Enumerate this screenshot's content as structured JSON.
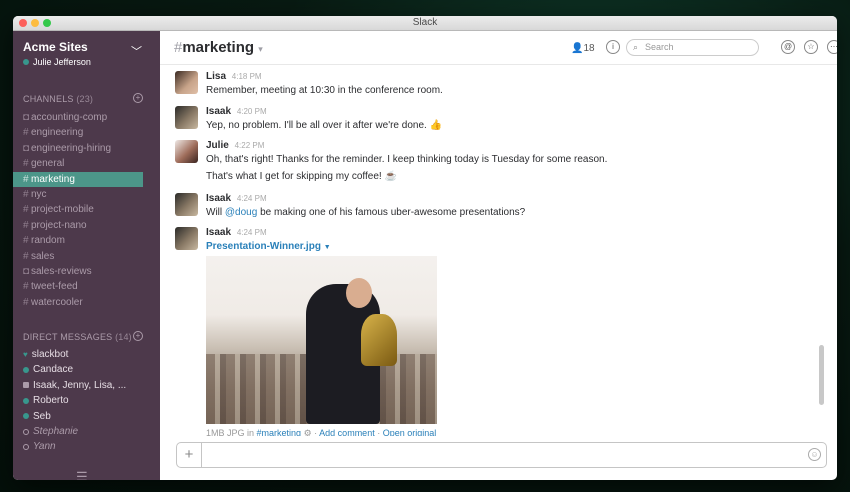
{
  "window": {
    "title": "Slack"
  },
  "team": {
    "name": "Acme Sites",
    "user": "Julie Jefferson"
  },
  "channels": {
    "header": "CHANNELS",
    "count": "(23)",
    "items": [
      {
        "prefix": "🔒",
        "name": "accounting-comp"
      },
      {
        "prefix": "#",
        "name": "engineering"
      },
      {
        "prefix": "🔒",
        "name": "engineering-hiring"
      },
      {
        "prefix": "#",
        "name": "general"
      },
      {
        "prefix": "#",
        "name": "marketing"
      },
      {
        "prefix": "#",
        "name": "nyc"
      },
      {
        "prefix": "#",
        "name": "project-mobile"
      },
      {
        "prefix": "#",
        "name": "project-nano"
      },
      {
        "prefix": "#",
        "name": "random"
      },
      {
        "prefix": "#",
        "name": "sales"
      },
      {
        "prefix": "🔒",
        "name": "sales-reviews"
      },
      {
        "prefix": "#",
        "name": "tweet-feed"
      },
      {
        "prefix": "#",
        "name": "watercooler"
      }
    ]
  },
  "direct_messages": {
    "header": "DIRECT MESSAGES",
    "count": "(14)",
    "items": [
      {
        "name": "slackbot"
      },
      {
        "name": "Candace"
      },
      {
        "name": "Isaak, Jenny, Lisa, ..."
      },
      {
        "name": "Roberto"
      },
      {
        "name": "Seb"
      },
      {
        "name": "Stephanie"
      },
      {
        "name": "Yann"
      }
    ]
  },
  "header": {
    "channel": "marketing",
    "members": "18",
    "search_placeholder": "Search"
  },
  "messages": [
    {
      "author": "Lisa",
      "time": "4:18 PM",
      "text": "Remember, meeting at 10:30 in the conference room."
    },
    {
      "author": "Isaak",
      "time": "4:20 PM",
      "text": "Yep, no problem. I'll be all over it after we're done. 👍"
    },
    {
      "author": "Julie",
      "time": "4:22 PM",
      "text": "Oh, that's right! Thanks for the reminder. I keep thinking today is Tuesday for some reason.",
      "text2": "That's what I get for skipping my coffee! ☕"
    },
    {
      "author": "Isaak",
      "time": "4:24 PM",
      "text_before": "Will ",
      "mention": "@doug",
      "text_after": " be making one of his famous uber-awesome presentations?"
    },
    {
      "author": "Isaak",
      "time": "4:24 PM",
      "file": "Presentation-Winner.jpg",
      "file_meta": "1MB JPG in",
      "file_channel": "#marketing",
      "add_comment": "Add comment",
      "open_original": "Open original"
    }
  ],
  "composer": {
    "placeholder": ""
  }
}
